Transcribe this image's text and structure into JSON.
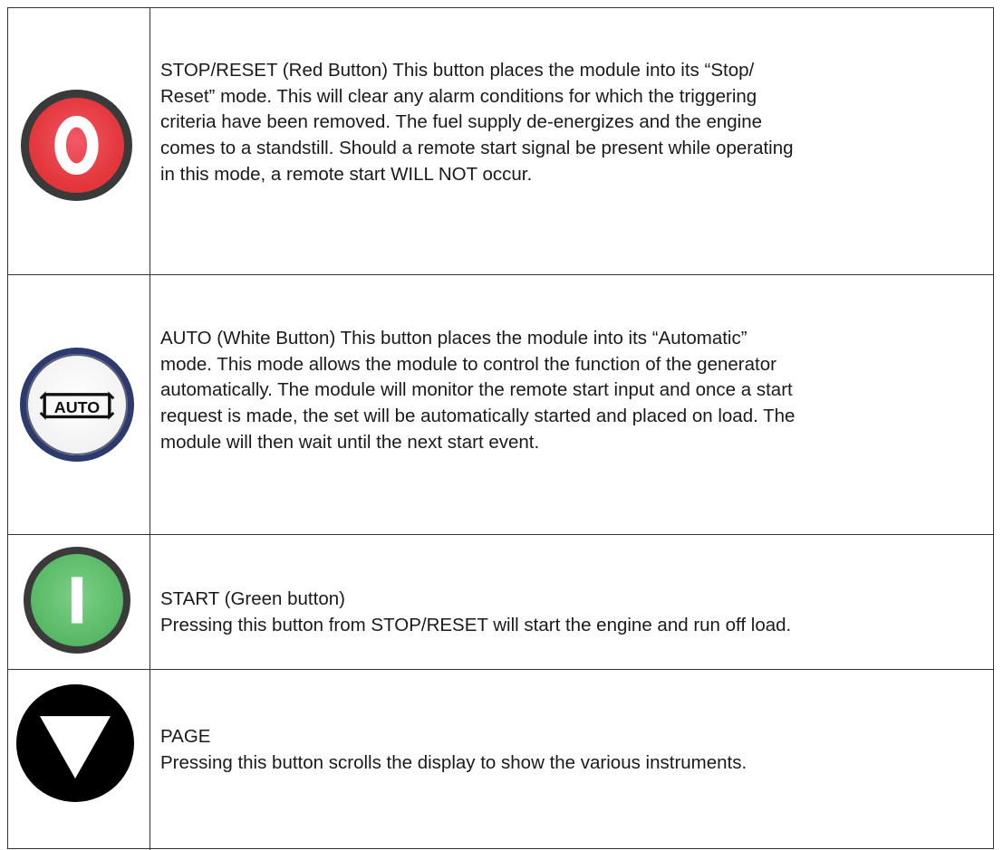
{
  "rows": [
    {
      "icon": "stop-reset-red-button-icon",
      "color": "#e4383e",
      "lines": [
        "STOP/RESET (Red Button)  This button places the module into its “Stop/",
        "Reset” mode.  This will clear any alarm conditions for which the triggering",
        "criteria have been removed.  The fuel supply de-energizes and the engine",
        "comes to a standstill.  Should a remote start signal be present while operating",
        "in this mode, a remote start WILL NOT occur."
      ]
    },
    {
      "icon": "auto-white-button-icon",
      "color": "#2d3a6e",
      "icon_label": "AUTO",
      "lines": [
        "AUTO (White Button)  This button places the module into its “Automatic”",
        "mode.  This mode allows the module to control the function of the generator",
        "automatically.  The module will monitor the remote start input and once a start",
        "request is made, the set will be automatically started and placed on load.  The",
        "module will then wait until the next start event."
      ]
    },
    {
      "icon": "start-green-button-icon",
      "color": "#5cbc6a",
      "lines": [
        "START (Green button)",
        "Pressing this button from STOP/RESET will start the engine and run off load."
      ]
    },
    {
      "icon": "page-down-triangle-button-icon",
      "color": "#000000",
      "lines": [
        "PAGE",
        "Pressing this button scrolls the display to show the various instruments."
      ]
    }
  ]
}
